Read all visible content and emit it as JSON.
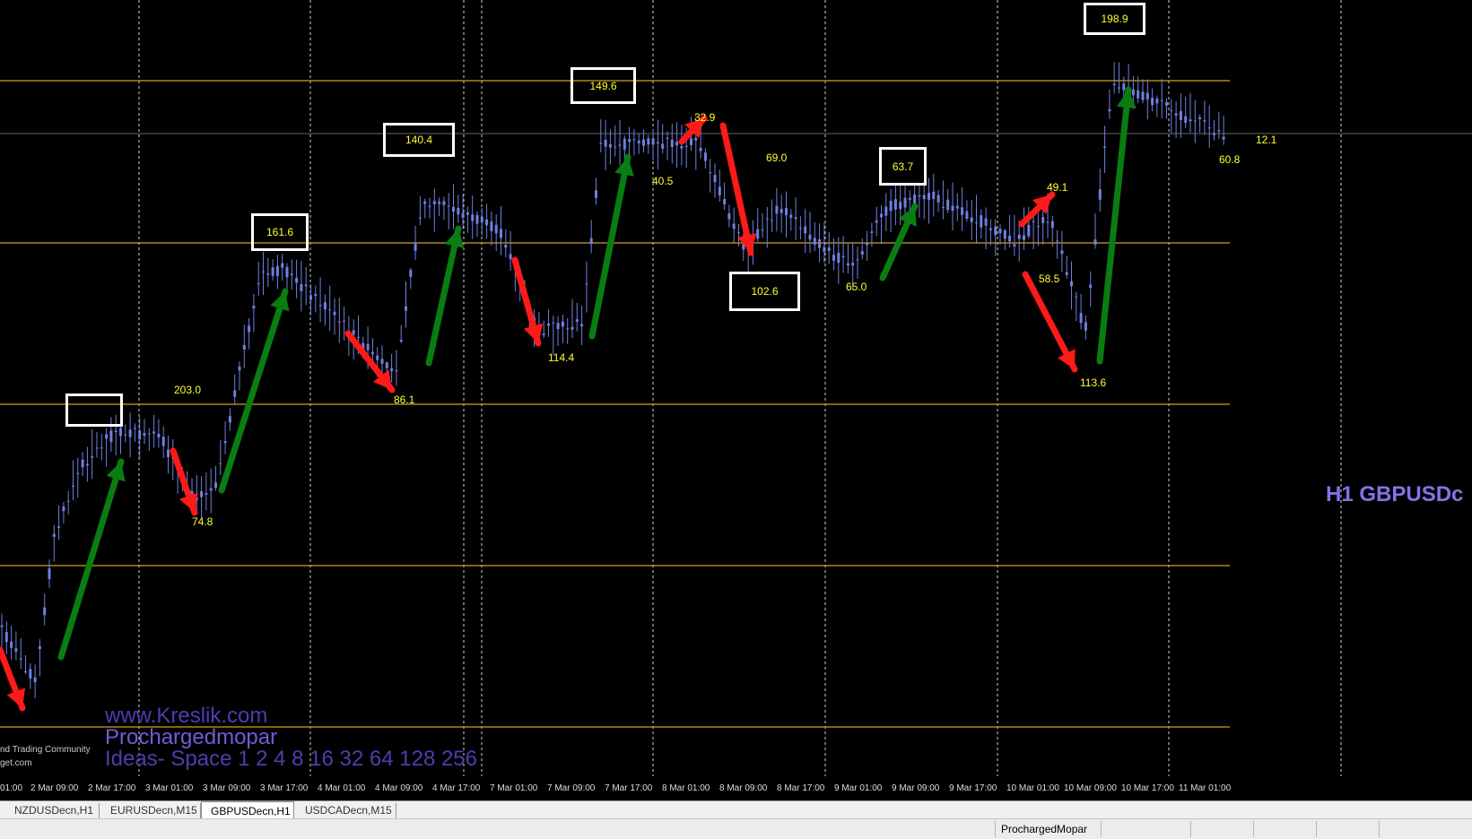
{
  "chart": {
    "symbol_label": "H1 GBPUSDc",
    "labels": [
      {
        "text": "203.0",
        "boxed": false
      },
      {
        "text": "74.8",
        "boxed": false
      },
      {
        "text": "161.6",
        "boxed": true
      },
      {
        "text": "86.1",
        "boxed": false
      },
      {
        "text": "140.4",
        "boxed": true
      },
      {
        "text": "114.4",
        "boxed": false
      },
      {
        "text": "149.6",
        "boxed": true
      },
      {
        "text": "40.5",
        "boxed": false
      },
      {
        "text": "32.9",
        "boxed": false
      },
      {
        "text": "69.0",
        "boxed": false
      },
      {
        "text": "102.6",
        "boxed": true
      },
      {
        "text": "65.0",
        "boxed": false
      },
      {
        "text": "63.7",
        "boxed": true
      },
      {
        "text": "49.1",
        "boxed": false
      },
      {
        "text": "58.5",
        "boxed": false
      },
      {
        "text": "113.6",
        "boxed": false
      },
      {
        "text": "198.9",
        "boxed": true
      },
      {
        "text": "60.8",
        "boxed": false
      },
      {
        "text": "12.1",
        "boxed": false
      },
      {
        "text": "",
        "boxed": true
      }
    ],
    "watermark": {
      "site": "www.Kreslik.com",
      "author": "Prochargedmopar",
      "ideas": "Ideas- Space 1 2 4 8 16 32 64 128 256",
      "community": "nd Trading Community",
      "site_tail": "get.com"
    },
    "time_axis": [
      "01:00",
      "2 Mar 09:00",
      "2 Mar 17:00",
      "3 Mar 01:00",
      "3 Mar 09:00",
      "3 Mar 17:00",
      "4 Mar 01:00",
      "4 Mar 09:00",
      "4 Mar 17:00",
      "7 Mar 01:00",
      "7 Mar 09:00",
      "7 Mar 17:00",
      "8 Mar 01:00",
      "8 Mar 09:00",
      "8 Mar 17:00",
      "9 Mar 01:00",
      "9 Mar 09:00",
      "9 Mar 17:00",
      "10 Mar 01:00",
      "10 Mar 09:00",
      "10 Mar 17:00",
      "11 Mar 01:00"
    ],
    "colors": {
      "candle": "#6f7fe0",
      "level": "#d4a020",
      "label": "#ffff33",
      "up_arrow": "#0a7d12",
      "down_arrow": "#ff1a1a",
      "watermark": "#5a4fc0"
    }
  },
  "tabs": [
    {
      "label": "NZDUSDecn,H1",
      "active": false
    },
    {
      "label": "EURUSDecn,M15",
      "active": false
    },
    {
      "label": "GBPUSDecn,H1",
      "active": true
    },
    {
      "label": "USDCADecn,M15",
      "active": false
    }
  ],
  "status": {
    "profile": "ProchargedMopar"
  }
}
